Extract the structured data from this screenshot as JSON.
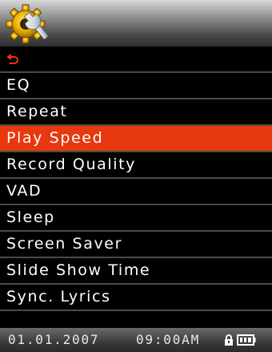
{
  "header": {
    "icon": "settings-gear-wrench-icon"
  },
  "menu": {
    "back_icon": "return-arrow-icon",
    "items": [
      {
        "label": "EQ",
        "selected": false
      },
      {
        "label": "Repeat",
        "selected": false
      },
      {
        "label": "Play Speed",
        "selected": true
      },
      {
        "label": "Record Quality",
        "selected": false
      },
      {
        "label": "VAD",
        "selected": false
      },
      {
        "label": "Sleep",
        "selected": false
      },
      {
        "label": "Screen Saver",
        "selected": false
      },
      {
        "label": "Slide Show Time",
        "selected": false
      },
      {
        "label": "Sync. Lyrics",
        "selected": false
      }
    ]
  },
  "status_bar": {
    "date": "01.01.2007",
    "time": "09:00AM",
    "lock_icon": "lock-icon",
    "battery_icon": "battery-icon"
  },
  "colors": {
    "highlight": "#e8380d",
    "background": "#000000",
    "text": "#ffffff",
    "back_arrow": "#e8380d",
    "gear": "#f2b400"
  }
}
